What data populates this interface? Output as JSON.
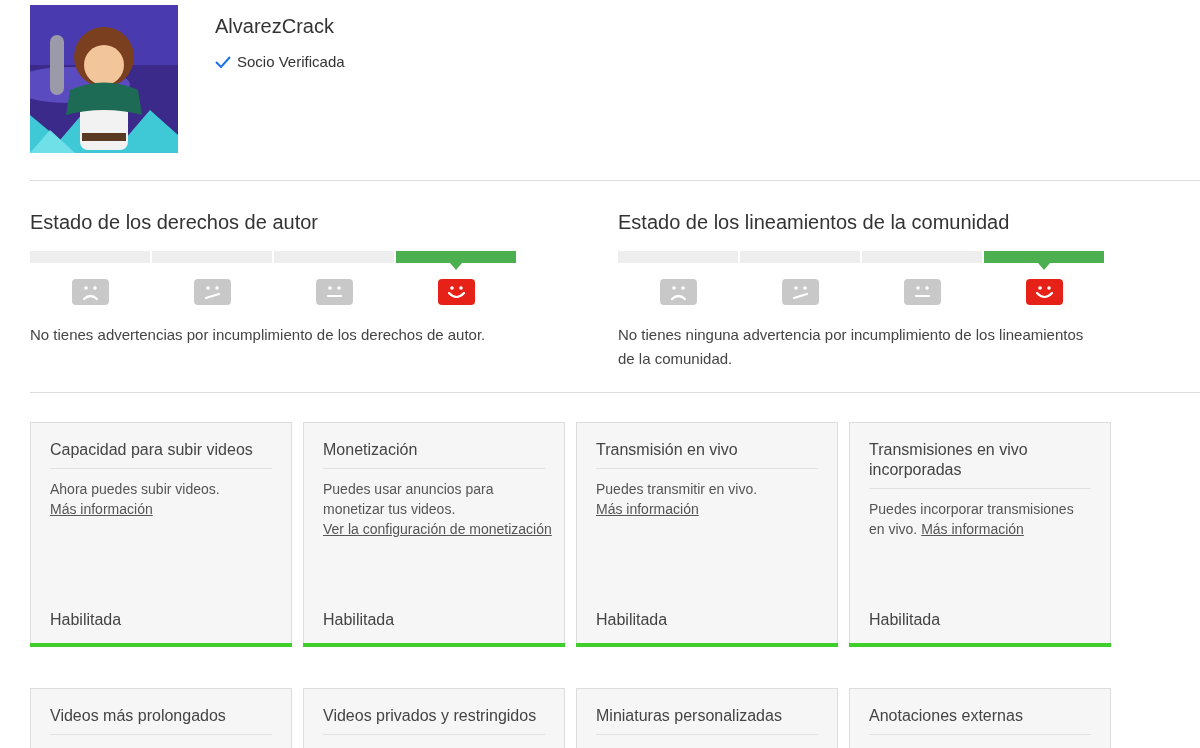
{
  "channel": {
    "name": "AlvarezCrack",
    "badge": "Socio Verificada",
    "verified": true
  },
  "standing": [
    {
      "title": "Estado de los derechos de autor",
      "levels": [
        {
          "kind": "sad",
          "selected": false
        },
        {
          "kind": "skeptical",
          "selected": false
        },
        {
          "kind": "neutral",
          "selected": false
        },
        {
          "kind": "happy",
          "selected": true
        }
      ],
      "message": "No tienes advertencias por incumplimiento de los derechos de autor."
    },
    {
      "title": "Estado de los lineamientos de la comunidad",
      "levels": [
        {
          "kind": "sad",
          "selected": false
        },
        {
          "kind": "skeptical",
          "selected": false
        },
        {
          "kind": "neutral",
          "selected": false
        },
        {
          "kind": "happy",
          "selected": true
        }
      ],
      "message": "No tienes ninguna advertencia por incumplimiento de los lineamientos de la comunidad."
    }
  ],
  "features": [
    {
      "title": "Capacidad para subir videos",
      "description": "Ahora puedes subir videos.",
      "link": "Más información",
      "status": "Habilitada",
      "enabled": true
    },
    {
      "title": "Monetización",
      "description": "Puedes usar anuncios para monetizar tus videos.",
      "link": "Ver la configuración de monetización",
      "status": "Habilitada",
      "enabled": true
    },
    {
      "title": "Transmisión en vivo",
      "description": "Puedes transmitir en vivo.",
      "link": "Más información",
      "status": "Habilitada",
      "enabled": true
    },
    {
      "title": "Transmisiones en vivo incorporadas",
      "description": "Puedes incorporar transmisiones en vivo.",
      "link": "Más información",
      "status": "Habilitada",
      "enabled": true
    },
    {
      "title": "Videos más prolongados"
    },
    {
      "title": "Videos privados y restringidos"
    },
    {
      "title": "Miniaturas personalizadas"
    },
    {
      "title": "Anotaciones externas"
    }
  ]
}
